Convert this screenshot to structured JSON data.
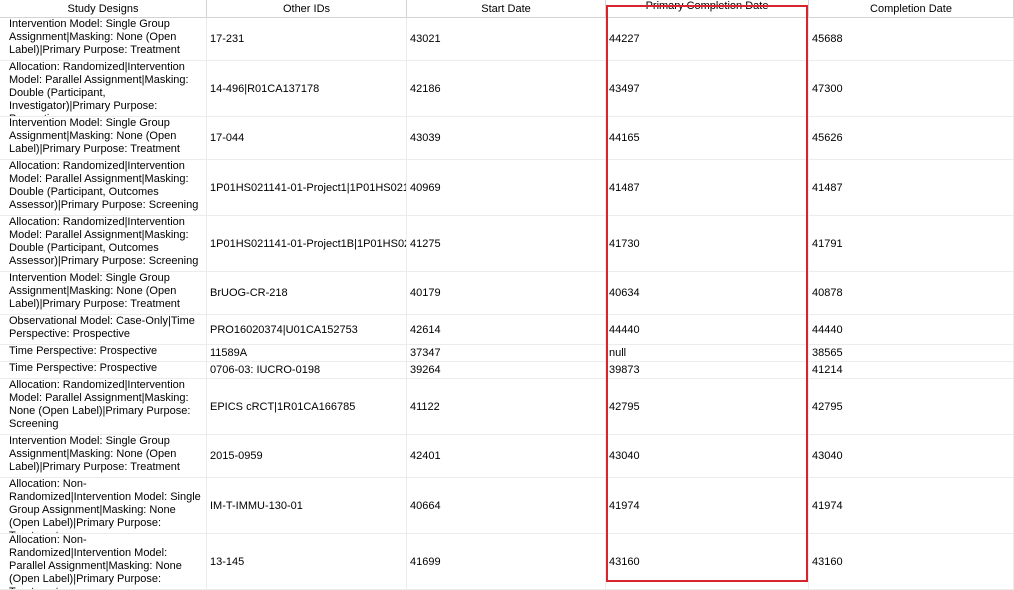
{
  "columns": [
    "Study Designs",
    "Other IDs",
    "Start Date",
    "Primary Completion Date",
    "Completion Date"
  ],
  "rows": [
    {
      "design": "Intervention Model: Single Group Assignment|Masking: None (Open Label)|Primary Purpose: Treatment",
      "other_ids": "17-231",
      "start": "43021",
      "primary": "44227",
      "completion": "45688"
    },
    {
      "design": "Allocation: Randomized|Intervention Model: Parallel Assignment|Masking: Double (Participant, Investigator)|Primary Purpose: Prevention",
      "other_ids": "14-496|R01CA137178",
      "start": "42186",
      "primary": "43497",
      "completion": "47300"
    },
    {
      "design": "Intervention Model: Single Group Assignment|Masking: None (Open Label)|Primary Purpose: Treatment",
      "other_ids": "17-044",
      "start": "43039",
      "primary": "44165",
      "completion": "45626"
    },
    {
      "design": "Allocation: Randomized|Intervention Model: Parallel Assignment|Masking: Double (Participant, Outcomes Assessor)|Primary Purpose: Screening",
      "other_ids": "1P01HS021141-01-Project1|1P01HS021",
      "start": "40969",
      "primary": "41487",
      "completion": "41487"
    },
    {
      "design": "Allocation: Randomized|Intervention Model: Parallel Assignment|Masking: Double (Participant, Outcomes Assessor)|Primary Purpose: Screening",
      "other_ids": "1P01HS021141-01-Project1B|1P01HS02",
      "start": "41275",
      "primary": "41730",
      "completion": "41791"
    },
    {
      "design": "Intervention Model: Single Group Assignment|Masking: None (Open Label)|Primary Purpose: Treatment",
      "other_ids": "BrUOG-CR-218",
      "start": "40179",
      "primary": "40634",
      "completion": "40878"
    },
    {
      "design": "Observational Model: Case-Only|Time Perspective: Prospective",
      "other_ids": "PRO16020374|U01CA152753",
      "start": "42614",
      "primary": "44440",
      "completion": "44440"
    },
    {
      "design": "Time Perspective: Prospective",
      "other_ids": "11589A",
      "start": "37347",
      "primary": "null",
      "completion": "38565"
    },
    {
      "design": "Time Perspective: Prospective",
      "other_ids": "0706-03: IUCRO-0198",
      "start": "39264",
      "primary": "39873",
      "completion": "41214"
    },
    {
      "design": "Allocation: Randomized|Intervention Model: Parallel Assignment|Masking: None (Open Label)|Primary Purpose: Screening",
      "other_ids": "EPICS cRCT|1R01CA166785",
      "start": "41122",
      "primary": "42795",
      "completion": "42795"
    },
    {
      "design": "Intervention Model: Single Group Assignment|Masking: None (Open Label)|Primary Purpose: Treatment",
      "other_ids": "2015-0959",
      "start": "42401",
      "primary": "43040",
      "completion": "43040"
    },
    {
      "design": "Allocation: Non-Randomized|Intervention Model: Single Group Assignment|Masking: None (Open Label)|Primary Purpose: Treatment",
      "other_ids": "IM-T-IMMU-130-01",
      "start": "40664",
      "primary": "41974",
      "completion": "41974"
    },
    {
      "design": "Allocation: Non-Randomized|Intervention Model: Parallel Assignment|Masking: None (Open Label)|Primary Purpose: Treatment",
      "other_ids": "13-145",
      "start": "41699",
      "primary": "43160",
      "completion": "43160"
    }
  ],
  "colors": {
    "highlight": "#d9232d",
    "grid_line": "#d4d4d4"
  }
}
